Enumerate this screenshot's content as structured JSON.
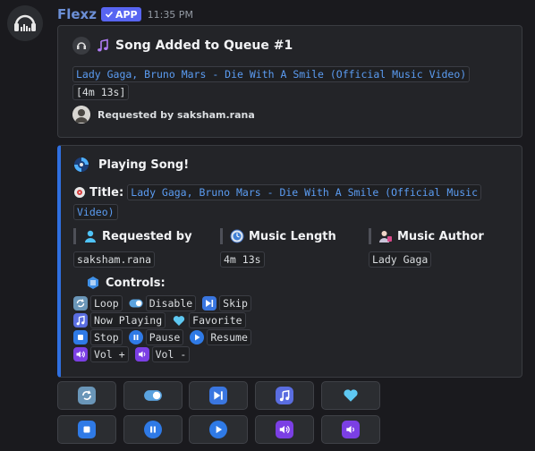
{
  "message": {
    "username": "Flexz",
    "badge": "APP",
    "timestamp": "11:35 PM"
  },
  "queue_embed": {
    "title": "Song Added to Queue #1",
    "song": "Lady Gaga, Bruno Mars - Die With A Smile (Official Music Video)",
    "length": "[4m 13s]",
    "footer": "Requested by saksham.rana"
  },
  "playing_embed": {
    "title": "Playing Song!",
    "title_label": "Title:",
    "song_line1": "Lady Gaga, Bruno Mars - Die With A Smile (Official Music",
    "song_line2": "Video)",
    "fields": [
      {
        "name": "Requested by",
        "value": "saksham.rana"
      },
      {
        "name": "Music Length",
        "value": "4m 13s"
      },
      {
        "name": "Music Author",
        "value": "Lady Gaga"
      }
    ],
    "controls_title": "Controls:",
    "controls": {
      "loop": "Loop",
      "disable": "Disable",
      "skip": "Skip",
      "now_playing": "Now Playing",
      "favorite": "Favorite",
      "stop": "Stop",
      "pause": "Pause",
      "resume": "Resume",
      "vol_up": "Vol +",
      "vol_down": "Vol -"
    }
  },
  "buttons_row1": [
    "loop-icon",
    "toggle-icon",
    "skip-icon",
    "music-note-icon",
    "heart-icon"
  ],
  "buttons_row2": [
    "stop-icon",
    "pause-icon",
    "play-icon",
    "volume-up-icon",
    "volume-down-icon"
  ],
  "colors": {
    "accent": "#2f6fe0",
    "link": "#5b9cf2",
    "brand": "#5865f2"
  }
}
